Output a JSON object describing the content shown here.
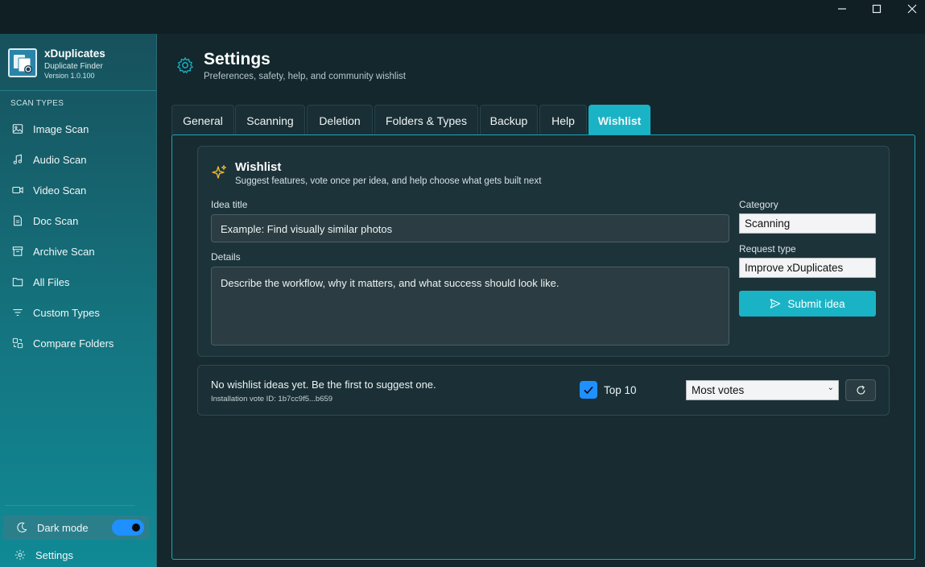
{
  "window": {
    "controls": [
      "minimize",
      "maximize",
      "close"
    ]
  },
  "sidebar": {
    "app_name": "xDuplicates",
    "app_subtitle": "Duplicate Finder",
    "version": "Version 1.0.100",
    "section_label": "SCAN TYPES",
    "items": [
      {
        "label": "Image Scan",
        "icon": "image-icon"
      },
      {
        "label": "Audio Scan",
        "icon": "music-note-icon"
      },
      {
        "label": "Video Scan",
        "icon": "video-camera-icon"
      },
      {
        "label": "Doc Scan",
        "icon": "document-icon"
      },
      {
        "label": "Archive Scan",
        "icon": "archive-box-icon"
      },
      {
        "label": "All Files",
        "icon": "folder-icon"
      },
      {
        "label": "Custom Types",
        "icon": "filter-icon"
      },
      {
        "label": "Compare Folders",
        "icon": "compare-icon"
      }
    ],
    "dark_mode_label": "Dark mode",
    "dark_mode_on": true,
    "settings_label": "Settings"
  },
  "header": {
    "title": "Settings",
    "subtitle": "Preferences, safety, help, and community wishlist"
  },
  "tabs": [
    {
      "label": "General",
      "active": false
    },
    {
      "label": "Scanning",
      "active": false
    },
    {
      "label": "Deletion",
      "active": false
    },
    {
      "label": "Folders & Types",
      "active": false
    },
    {
      "label": "Backup",
      "active": false
    },
    {
      "label": "Help",
      "active": false
    },
    {
      "label": "Wishlist",
      "active": true
    }
  ],
  "wishlist": {
    "title": "Wishlist",
    "subtitle": "Suggest features, vote once per idea, and help choose what gets built next",
    "idea_title_label": "Idea title",
    "idea_title_placeholder": "Example: Find visually similar photos",
    "details_label": "Details",
    "details_placeholder": "Describe the workflow, why it matters, and what success should look like.",
    "category_label": "Category",
    "category_value": "Scanning",
    "request_type_label": "Request type",
    "request_type_value": "Improve xDuplicates",
    "submit_label": "Submit idea"
  },
  "ideas_list": {
    "empty_message": "No wishlist ideas yet. Be the first to suggest one.",
    "vote_id": "Installation vote ID: 1b7cc9f5...b659",
    "top10_label": "Top 10",
    "top10_checked": true,
    "sort_value": "Most votes"
  },
  "colors": {
    "accent": "#1ab3c6",
    "toggle_blue": "#1e90ff",
    "sparkle": "#f0b429"
  }
}
